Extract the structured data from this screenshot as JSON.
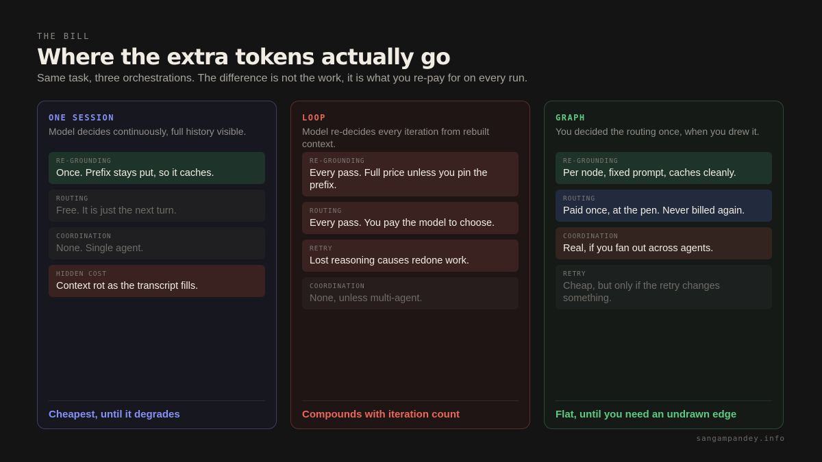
{
  "header": {
    "eyebrow": "THE BILL",
    "title": "Where the extra tokens actually go",
    "subtitle": "Same task, three orchestrations. The difference is not the work, it is what you re-pay for on every run."
  },
  "cards": [
    {
      "label": "ONE SESSION",
      "description": "Model decides continuously, full history visible.",
      "accent": "#8592f5",
      "items": [
        {
          "label": "RE-GROUNDING",
          "text": "Once. Prefix stays put, so it caches.",
          "tone": "green"
        },
        {
          "label": "ROUTING",
          "text": "Free. It is just the next turn.",
          "tone": "dim"
        },
        {
          "label": "COORDINATION",
          "text": "None. Single agent.",
          "tone": "dim"
        },
        {
          "label": "HIDDEN COST",
          "text": "Context rot as the transcript fills.",
          "tone": "red"
        }
      ],
      "footer": "Cheapest, until it degrades"
    },
    {
      "label": "LOOP",
      "description": "Model re-decides every iteration from rebuilt context.",
      "accent": "#e8685a",
      "items": [
        {
          "label": "RE-GROUNDING",
          "text": "Every pass. Full price unless you pin the prefix.",
          "tone": "red"
        },
        {
          "label": "ROUTING",
          "text": "Every pass. You pay the model to choose.",
          "tone": "red"
        },
        {
          "label": "RETRY",
          "text": "Lost reasoning causes redone work.",
          "tone": "red"
        },
        {
          "label": "COORDINATION",
          "text": "None, unless multi-agent.",
          "tone": "dim"
        }
      ],
      "footer": "Compounds with iteration count"
    },
    {
      "label": "GRAPH",
      "description": "You decided the routing once, when you drew it.",
      "accent": "#5fc983",
      "items": [
        {
          "label": "RE-GROUNDING",
          "text": "Per node, fixed prompt, caches cleanly.",
          "tone": "green"
        },
        {
          "label": "ROUTING",
          "text": "Paid once, at the pen. Never billed again.",
          "tone": "blue"
        },
        {
          "label": "COORDINATION",
          "text": "Real, if you fan out across agents.",
          "tone": "brown"
        },
        {
          "label": "RETRY",
          "text": "Cheap, but only if the retry changes something.",
          "tone": "dim"
        }
      ],
      "footer": "Flat, until you need an undrawn edge"
    }
  ],
  "footer": {
    "credit": "sangampandey.info"
  }
}
